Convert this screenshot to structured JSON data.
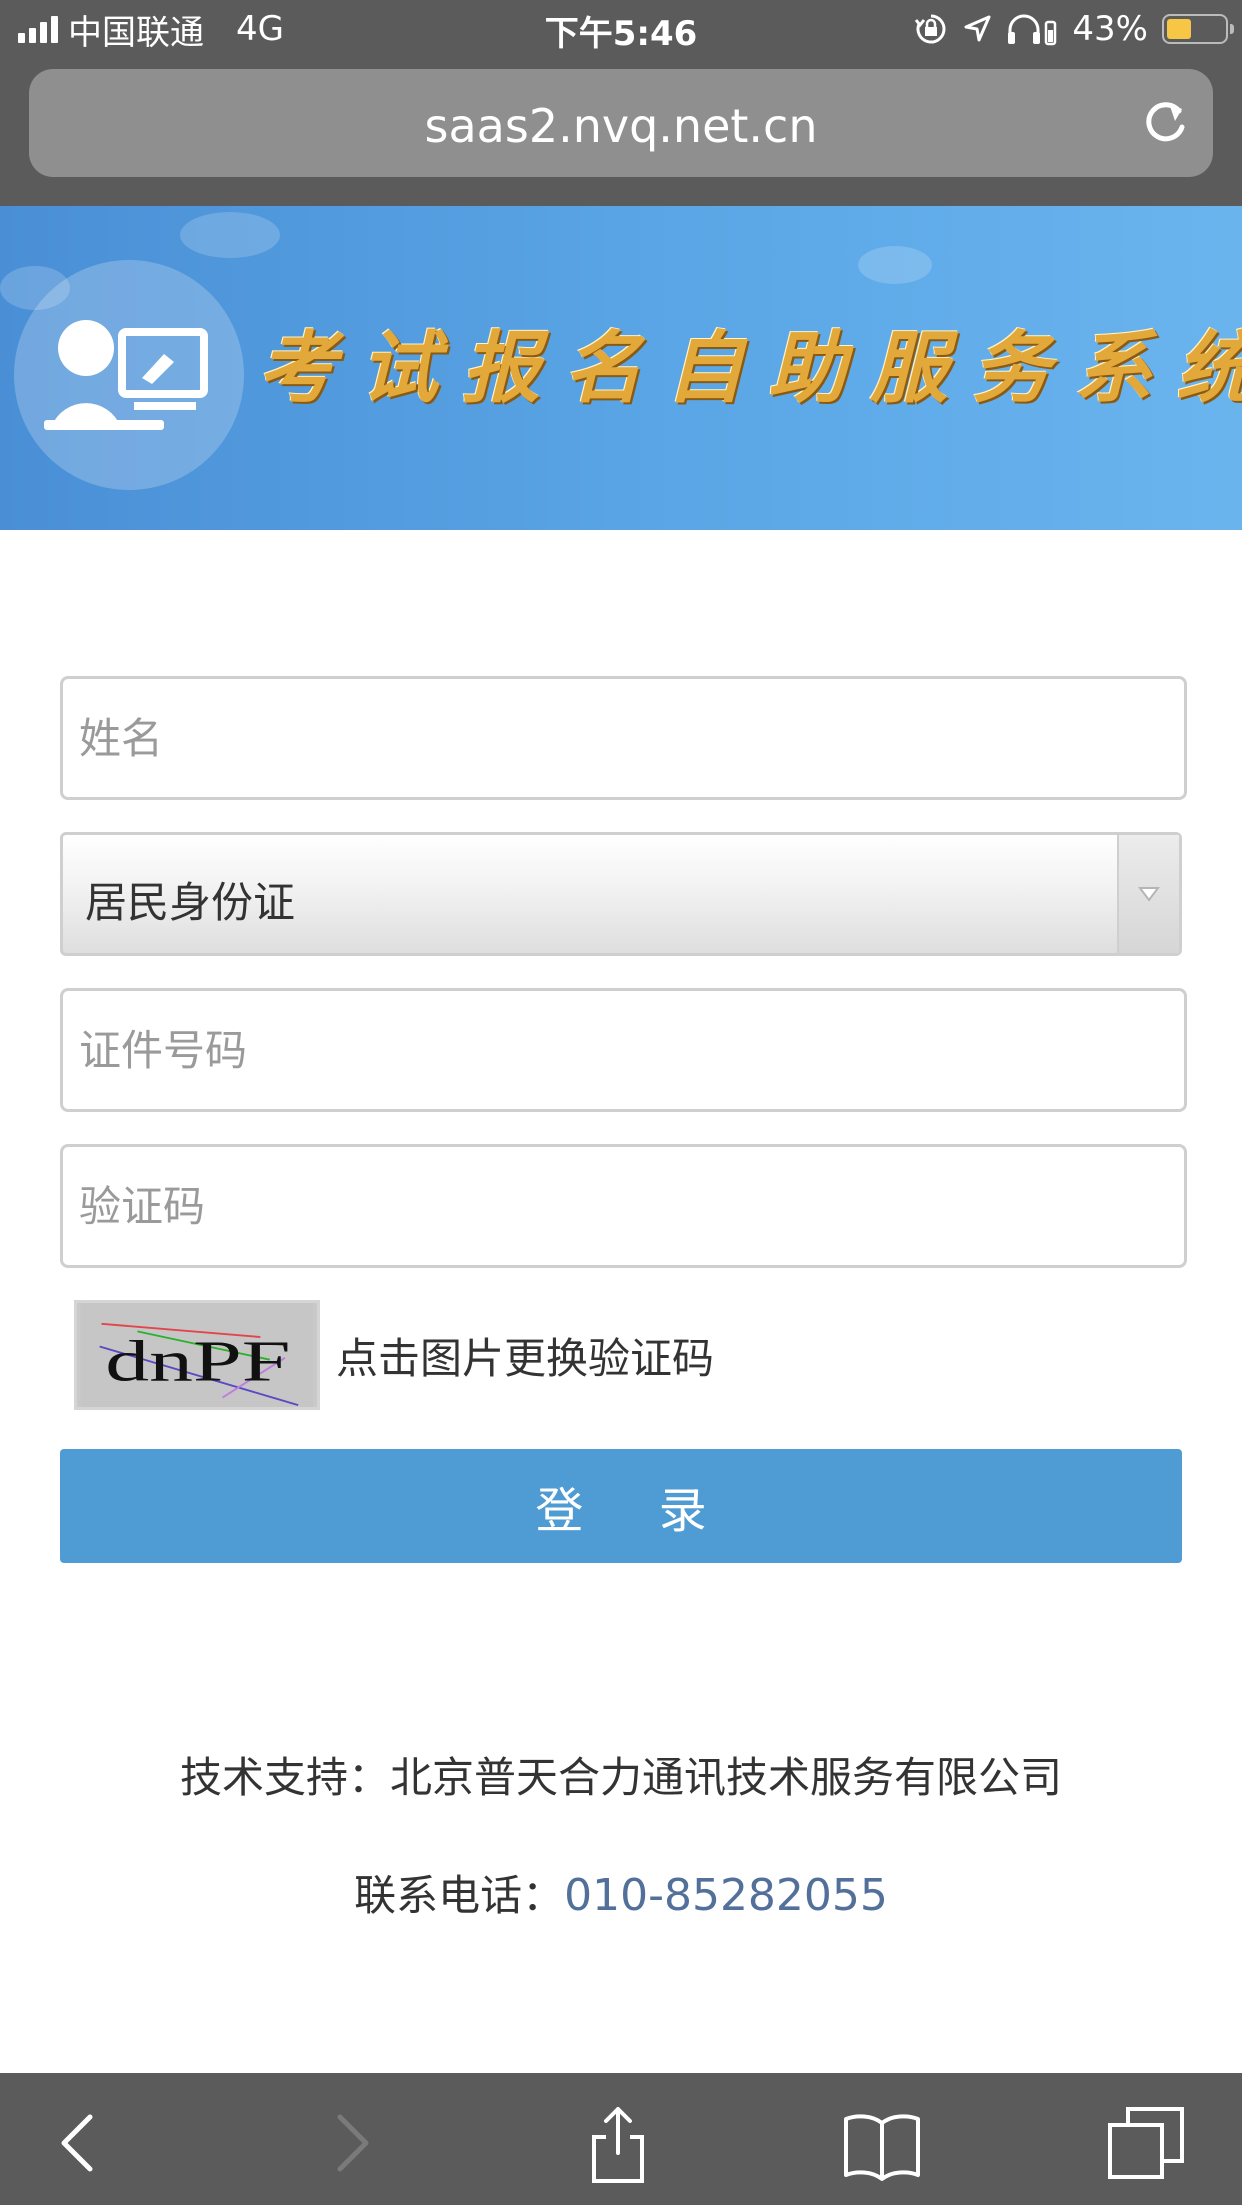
{
  "status_bar": {
    "carrier": "中国联通",
    "network": "4G",
    "time": "下午5:46",
    "battery_percent": "43%",
    "battery_level": 0.43
  },
  "browser": {
    "url": "saas2.nvq.net.cn"
  },
  "banner": {
    "title": "考试报名自助服务系统"
  },
  "form": {
    "name_placeholder": "姓名",
    "id_type_selected": "居民身份证",
    "id_number_placeholder": "证件号码",
    "captcha_placeholder": "验证码",
    "captcha_image_text": "dnPF",
    "captcha_hint": "点击图片更换验证码",
    "login_label": "登 录"
  },
  "footer": {
    "support_text": "技术支持：北京普天合力通讯技术服务有限公司",
    "contact_label": "联系电话：",
    "contact_phone": "010-85282055"
  },
  "colors": {
    "accent": "#4f9bd3",
    "banner": "#5aa6e6",
    "title_gold": "#e2a83a",
    "phone": "#53709a",
    "chrome": "#5b5b5b"
  },
  "icons": {
    "back": "back-icon",
    "forward": "forward-icon",
    "share": "share-icon",
    "bookmarks": "bookmarks-icon",
    "tabs": "tabs-icon",
    "reload": "reload-icon"
  }
}
